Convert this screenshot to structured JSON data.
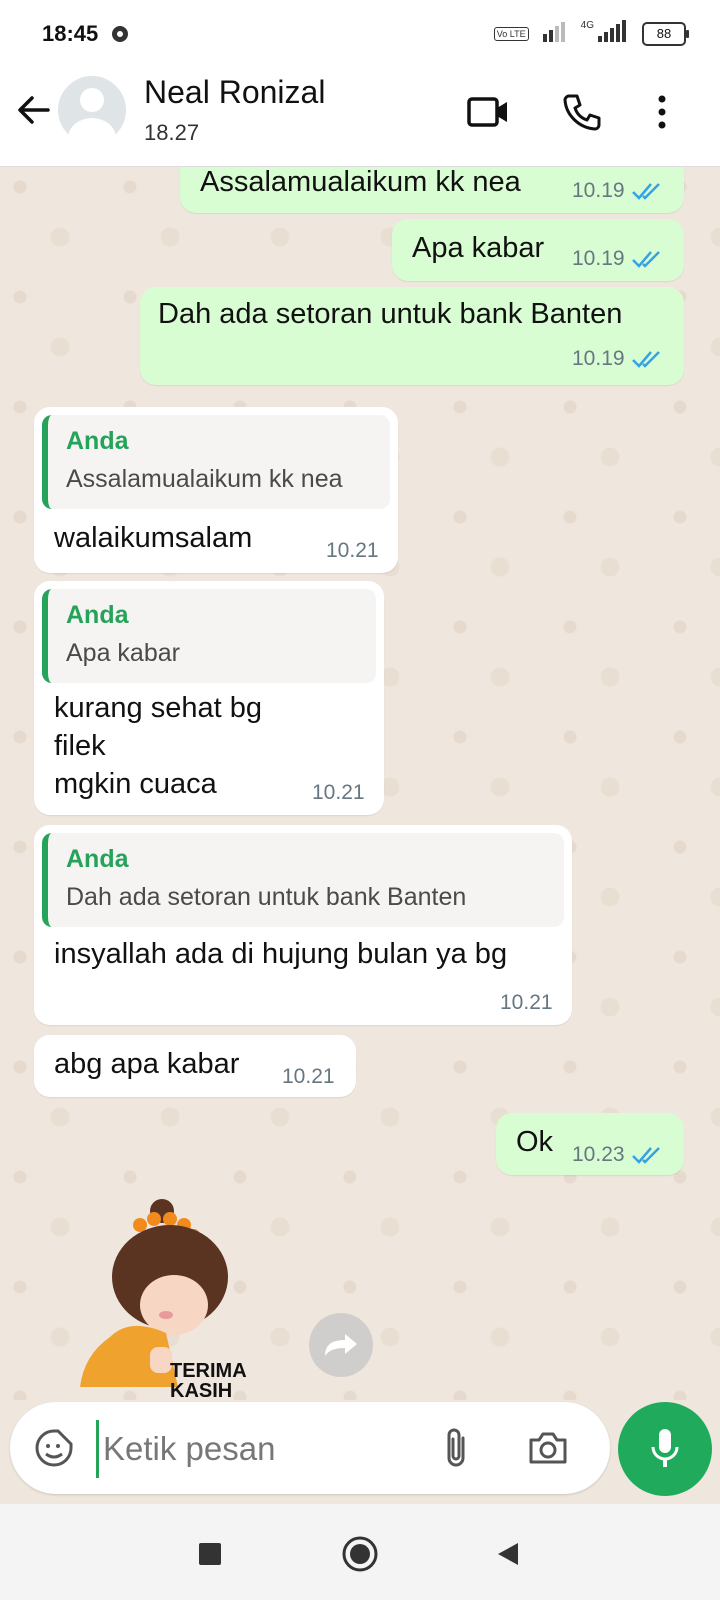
{
  "status_bar": {
    "time": "18:45",
    "battery": "88",
    "network": "4G",
    "volte": "Vo LTE"
  },
  "header": {
    "contact_name": "Neal Ronizal",
    "last_seen": "18.27"
  },
  "messages": [
    {
      "text": "Assalamualaikum kk nea",
      "time": "10.19",
      "direction": "out"
    },
    {
      "text": "Apa kabar",
      "time": "10.19",
      "direction": "out"
    },
    {
      "text": "Dah ada setoran untuk bank Banten",
      "time": "10.19",
      "direction": "out"
    },
    {
      "quote_author": "Anda",
      "quote_text": "Assalamualaikum kk nea",
      "text": "walaikumsalam",
      "time": "10.21",
      "direction": "in"
    },
    {
      "quote_author": "Anda",
      "quote_text": "Apa kabar",
      "text": "kurang sehat bg\nfilek\nmgkin cuaca",
      "time": "10.21",
      "direction": "in"
    },
    {
      "quote_author": "Anda",
      "quote_text": "Dah ada setoran untuk bank Banten",
      "text": "insyallah ada di hujung bulan ya bg",
      "time": "10.21",
      "direction": "in"
    },
    {
      "text": "abg apa kabar",
      "time": "10.21",
      "direction": "in"
    },
    {
      "text": "Ok",
      "time": "10.23",
      "direction": "out"
    }
  ],
  "sticker": {
    "caption_line1": "TERIMA",
    "caption_line2": "KASIH"
  },
  "composer": {
    "placeholder": "Ketik pesan"
  },
  "colors": {
    "accent": "#1faa5c",
    "outgoing_bubble": "#d9fdd3",
    "incoming_bubble": "#ffffff",
    "tick_blue": "#34a3e6",
    "quote_author": "#25a35a"
  }
}
